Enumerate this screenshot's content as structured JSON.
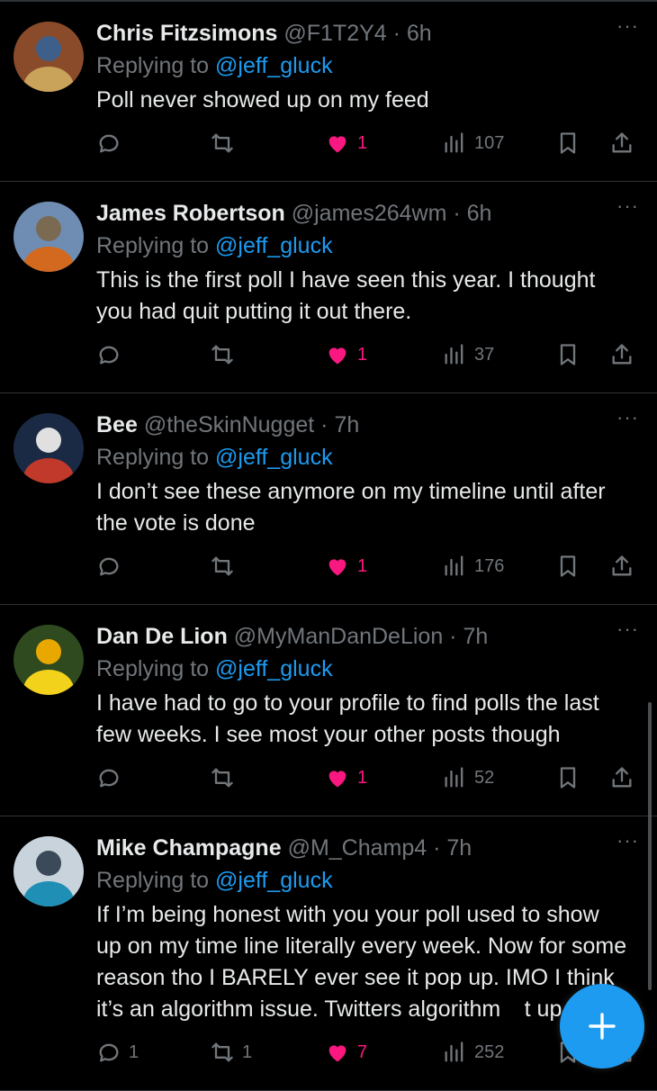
{
  "replies": [
    {
      "name": "Chris Fitzsimons",
      "handle": "@F1T2Y4",
      "time": "6h",
      "replying_label": "Replying to",
      "replying_to": "@jeff_gluck",
      "text": "Poll never showed up on my feed",
      "replies": "",
      "retweets": "",
      "likes": "1",
      "views": "107",
      "avatar_colors": [
        "#8a4b2a",
        "#c9a35a",
        "#3d5f8a"
      ]
    },
    {
      "name": "James Robertson",
      "handle": "@james264wm",
      "time": "6h",
      "replying_label": "Replying to",
      "replying_to": "@jeff_gluck",
      "text": "This is the first poll I have seen this year. I thought you had quit putting it out there.",
      "replies": "",
      "retweets": "",
      "likes": "1",
      "views": "37",
      "avatar_colors": [
        "#6f8db3",
        "#d2691e",
        "#7a6a52"
      ]
    },
    {
      "name": "Bee",
      "handle": "@theSkinNugget",
      "time": "7h",
      "replying_label": "Replying to",
      "replying_to": "@jeff_gluck",
      "text": "I don’t see these anymore on my timeline until after the vote is done",
      "replies": "",
      "retweets": "",
      "likes": "1",
      "views": "176",
      "avatar_colors": [
        "#1b2a44",
        "#c0392b",
        "#e0e0e0"
      ]
    },
    {
      "name": "Dan De Lion",
      "handle": "@MyManDanDeLion",
      "time": "7h",
      "replying_label": "Replying to",
      "replying_to": "@jeff_gluck",
      "text": "I have had to go to your profile to find polls the last few weeks. I see most your other posts though",
      "replies": "",
      "retweets": "",
      "likes": "1",
      "views": "52",
      "avatar_colors": [
        "#2e4a1e",
        "#f2d21b",
        "#e9a800"
      ]
    },
    {
      "name": "Mike Champagne",
      "handle": "@M_Champ4",
      "time": "7h",
      "replying_label": "Replying to",
      "replying_to": "@jeff_gluck",
      "text": "If I’m being honest with you your poll used to show up on my time line literally every week. Now for some reason tho I BARELY ever see it pop up. IMO I think it’s an algorithm issue. Twitters algorithm   t up sucks",
      "replies": "1",
      "retweets": "1",
      "likes": "7",
      "views": "252",
      "avatar_colors": [
        "#c8d3dc",
        "#1f8fb5",
        "#3b4a58"
      ]
    }
  ],
  "fab": {
    "icon": "plus-icon"
  },
  "colors": {
    "accent": "#1d9bf0",
    "like": "#f91880",
    "muted": "#71767b",
    "border": "#2f3336"
  }
}
